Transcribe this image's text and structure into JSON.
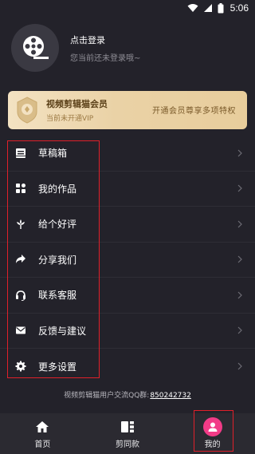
{
  "status": {
    "time": "5:06"
  },
  "profile": {
    "login_title": "点击登录",
    "login_subtitle": "您当前还未登录哦~"
  },
  "vip": {
    "title": "视频剪辑猫会员",
    "subtitle": "当前未开通VIP",
    "cta": "开通会员尊享多项特权"
  },
  "menu": {
    "items": [
      {
        "label": "草稿箱",
        "icon": "drafts-icon"
      },
      {
        "label": "我的作品",
        "icon": "works-grid-icon"
      },
      {
        "label": "给个好评",
        "icon": "flower-like-icon"
      },
      {
        "label": "分享我们",
        "icon": "share-arrow-icon"
      },
      {
        "label": "联系客服",
        "icon": "headset-icon"
      },
      {
        "label": "反馈与建议",
        "icon": "envelope-icon"
      },
      {
        "label": "更多设置",
        "icon": "settings-gear-icon"
      }
    ]
  },
  "community": {
    "prefix": "视频剪辑猫用户交流QQ群:",
    "number": "850242732"
  },
  "tabbar": {
    "home": "首页",
    "template": "剪同款",
    "mine": "我的"
  },
  "colors": {
    "background": "#23222a",
    "vip_gold": "#ead2a6",
    "active_tab": "#f23b87",
    "highlight": "#e0202a"
  }
}
